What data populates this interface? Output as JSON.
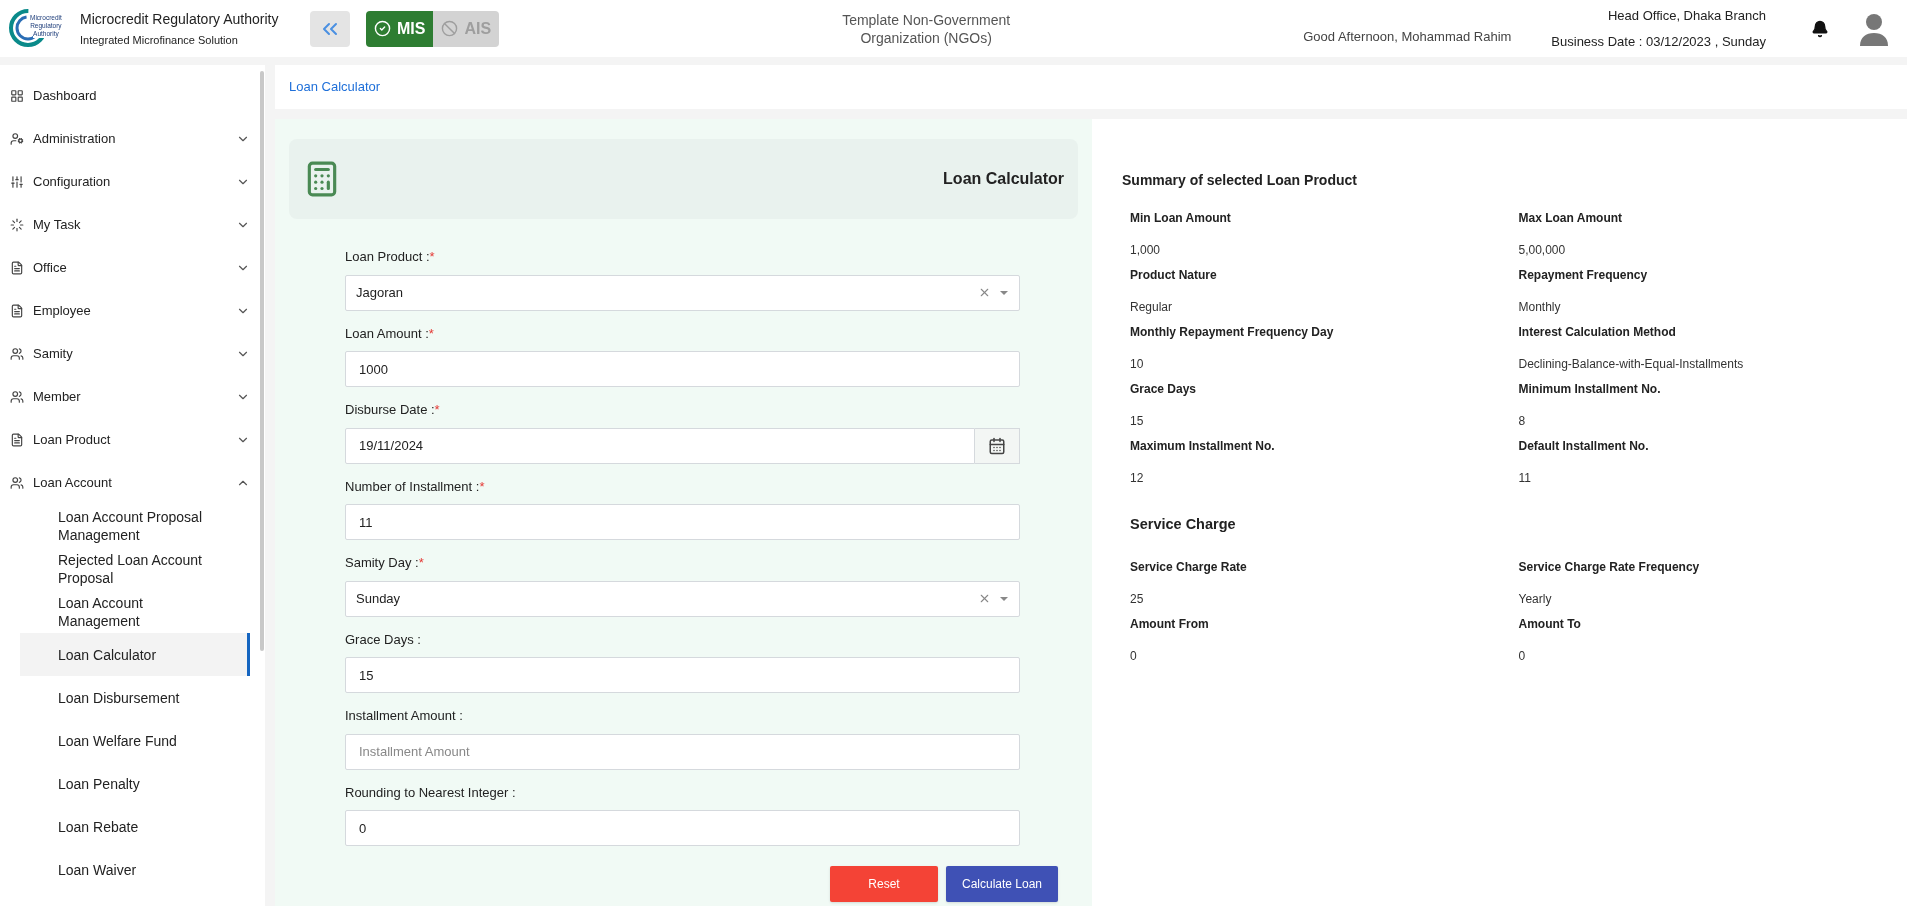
{
  "header": {
    "logo_lines": [
      "Microcredit",
      "Regulatory",
      "Authority"
    ],
    "app_title": "Microcredit Regulatory Authority",
    "app_subtitle": "Integrated Microfinance Solution",
    "modules": [
      {
        "label": "MIS",
        "selected": true
      },
      {
        "label": "AIS",
        "selected": false
      }
    ],
    "org_name": "Template Non-Government Organization (NGOs)",
    "greeting": "Good Afternoon, Mohammad Rahim",
    "branch": "Head Office, Dhaka Branch",
    "business_date": "Business Date : 03/12/2023 , Sunday"
  },
  "sidebar": {
    "items": [
      {
        "label": "Dashboard"
      },
      {
        "label": "Administration",
        "expanded": false
      },
      {
        "label": "Configuration",
        "expanded": false
      },
      {
        "label": "My Task",
        "expanded": false
      },
      {
        "label": "Office",
        "expanded": false
      },
      {
        "label": "Employee",
        "expanded": false
      },
      {
        "label": "Samity",
        "expanded": false
      },
      {
        "label": "Member",
        "expanded": false
      },
      {
        "label": "Loan Product",
        "expanded": false
      },
      {
        "label": "Loan Account",
        "expanded": true,
        "children": [
          {
            "label": "Loan Account Proposal Management",
            "selected": false
          },
          {
            "label": "Rejected Loan Account Proposal",
            "selected": false
          },
          {
            "label": "Loan Account Management",
            "selected": false
          },
          {
            "label": "Loan Calculator",
            "selected": true
          },
          {
            "label": "Loan Disbursement",
            "selected": false
          },
          {
            "label": "Loan Welfare Fund",
            "selected": false
          },
          {
            "label": "Loan Penalty",
            "selected": false
          },
          {
            "label": "Loan Rebate",
            "selected": false
          },
          {
            "label": "Loan Waiver",
            "selected": false
          }
        ]
      }
    ]
  },
  "breadcrumb": "Loan Calculator",
  "form": {
    "title": "Loan Calculator",
    "fields": [
      {
        "kind": "select",
        "label": "Loan Product :",
        "required_mark": "*",
        "value": "Jagoran"
      },
      {
        "kind": "text",
        "label": "Loan Amount :",
        "required_mark": "*",
        "value": "1000"
      },
      {
        "kind": "date",
        "label": "Disburse Date :",
        "required_mark": "*",
        "value": "19/11/2024"
      },
      {
        "kind": "text",
        "label": "Number of Installment :",
        "required_mark": "*",
        "value": "11"
      },
      {
        "kind": "select",
        "label": "Samity Day :",
        "required_mark": "*",
        "value": "Sunday"
      },
      {
        "kind": "text",
        "label": "Grace Days :",
        "value": "15"
      },
      {
        "kind": "text",
        "label": "Installment Amount :",
        "placeholder": "Installment Amount"
      },
      {
        "kind": "text",
        "label": "Rounding to Nearest Integer :",
        "value": "0"
      }
    ],
    "buttons": [
      {
        "kind": "reset",
        "label": "Reset"
      },
      {
        "kind": "primary",
        "label": "Calculate Loan"
      }
    ]
  },
  "summary": {
    "title": "Summary of selected Loan Product",
    "fields": [
      {
        "label": "Min Loan Amount",
        "value": "1,000"
      },
      {
        "label": "Max Loan Amount",
        "value": "5,00,000"
      },
      {
        "label": "Product Nature",
        "value": "Regular"
      },
      {
        "label": "Repayment Frequency",
        "value": "Monthly"
      },
      {
        "label": "Monthly Repayment Frequency Day",
        "value": "10"
      },
      {
        "label": "Interest Calculation Method",
        "value": "Declining-Balance-with-Equal-Installments"
      },
      {
        "label": "Grace Days",
        "value": "15"
      },
      {
        "label": "Minimum Installment No.",
        "value": "8"
      },
      {
        "label": "Maximum Installment No.",
        "value": "12"
      },
      {
        "label": "Default Installment No.",
        "value": "11"
      }
    ],
    "service_charge": {
      "title": "Service Charge",
      "fields": [
        {
          "label": "Service Charge Rate",
          "value": "25"
        },
        {
          "label": "Service Charge Rate Frequency",
          "value": "Yearly"
        },
        {
          "label": "Amount From",
          "value": "0"
        },
        {
          "label": "Amount To",
          "value": "0"
        }
      ]
    }
  }
}
